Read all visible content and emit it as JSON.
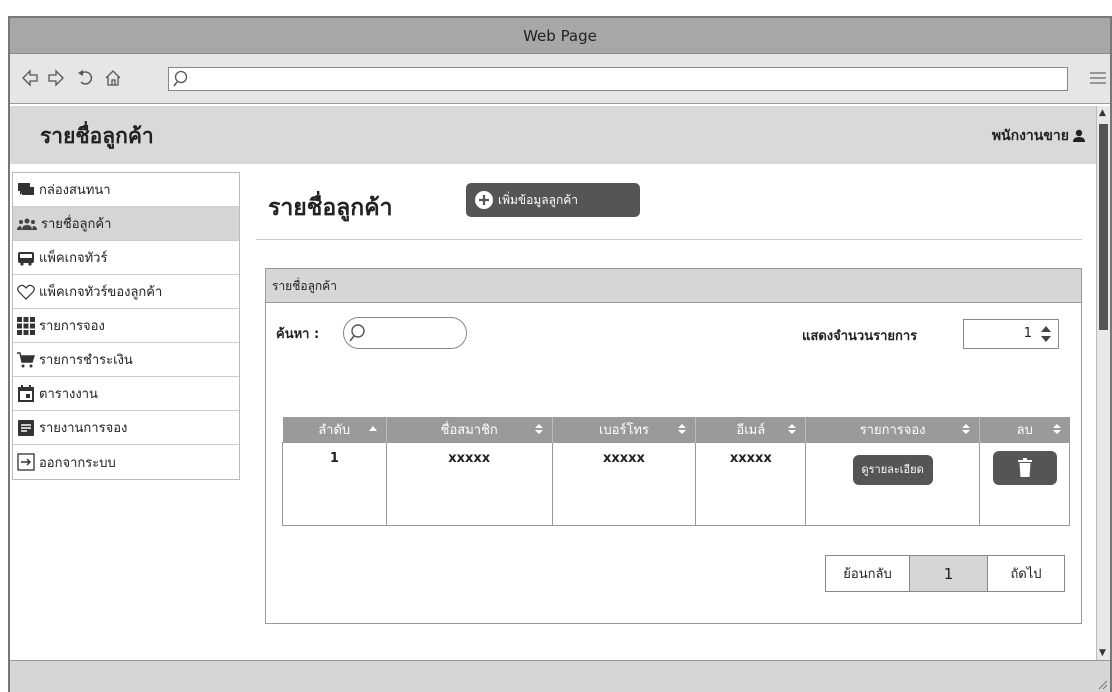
{
  "window": {
    "title": "Web Page"
  },
  "browser": {
    "url": ""
  },
  "header": {
    "title": "รายชื่อลูกค้า",
    "user_label": "พนักงานขาย"
  },
  "sidebar": {
    "items": [
      {
        "label": "กล่องสนทนา",
        "icon": "chat-icon"
      },
      {
        "label": "รายชื่อลูกค้า",
        "icon": "users-icon",
        "active": true
      },
      {
        "label": "แพ็คเกจทัวร์",
        "icon": "bus-icon"
      },
      {
        "label": "แพ็คเกจทัวร์ของลูกค้า",
        "icon": "heart-icon"
      },
      {
        "label": "รายการจอง",
        "icon": "grid-icon"
      },
      {
        "label": "รายการชำระเงิน",
        "icon": "cart-icon"
      },
      {
        "label": "ตารางงาน",
        "icon": "calendar-icon"
      },
      {
        "label": "รายงานการจอง",
        "icon": "report-icon"
      },
      {
        "label": "ออกจากระบบ",
        "icon": "logout-icon"
      }
    ]
  },
  "main": {
    "title": "รายชื่อลูกค้า",
    "add_button": "เพิ่มข้อมูลลูกค้า",
    "panel_title": "รายชื่อลูกค้า",
    "search_label": "ค้นหา :",
    "search_value": "",
    "show_label": "แสดงจำนวนรายการ",
    "show_value": "1",
    "table": {
      "columns": [
        "ลำดับ",
        "ชื่อสมาชิก",
        "เบอร์โทร",
        "อีเมล์",
        "รายการจอง",
        "ลบ"
      ],
      "rows": [
        {
          "no": "1",
          "name": "xxxxx",
          "phone": "xxxxx",
          "email": "xxxxx",
          "detail_button": "ดูรายละเอียด"
        }
      ]
    },
    "pagination": {
      "prev": "ย้อนกลับ",
      "page": "1",
      "next": "ถัดไป"
    }
  }
}
